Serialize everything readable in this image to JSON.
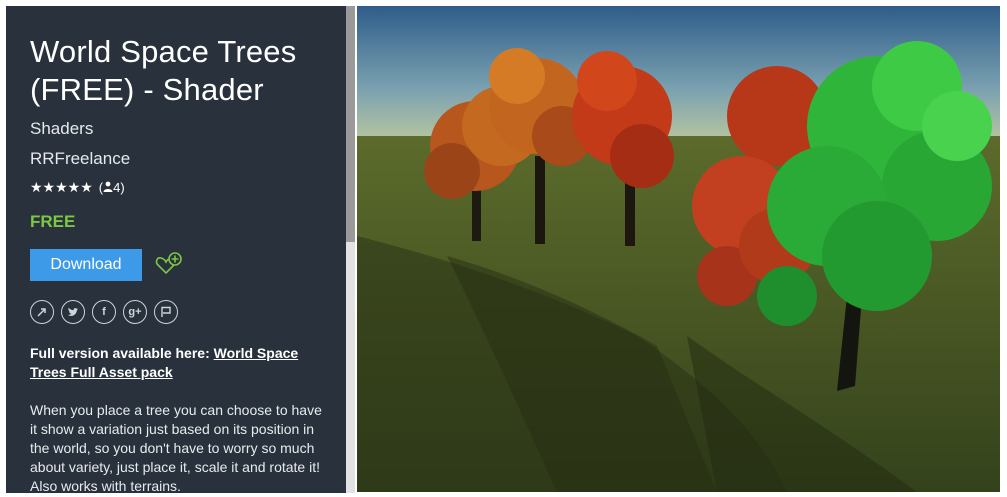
{
  "asset": {
    "title": "World Space Trees (FREE) - Shader",
    "category": "Shaders",
    "publisher": "RRFreelance",
    "stars": "★★★★★",
    "rating_count": "4",
    "price": "FREE"
  },
  "actions": {
    "download_label": "Download"
  },
  "social_icons": [
    "share-icon",
    "twitter-icon",
    "facebook-icon",
    "google-plus-icon",
    "flag-icon"
  ],
  "description": {
    "full_prefix": "Full version available here: ",
    "full_link": "World Space Trees Full Asset pack",
    "body": "When you place a tree you can choose to have it show a variation just based on its position in the world, so you don't have to worry so much about variety, just place it, scale it and rotate it! Also works with terrains."
  },
  "colors": {
    "panel_bg": "#28313c",
    "price": "#7cc743",
    "button": "#3c9ae8"
  }
}
